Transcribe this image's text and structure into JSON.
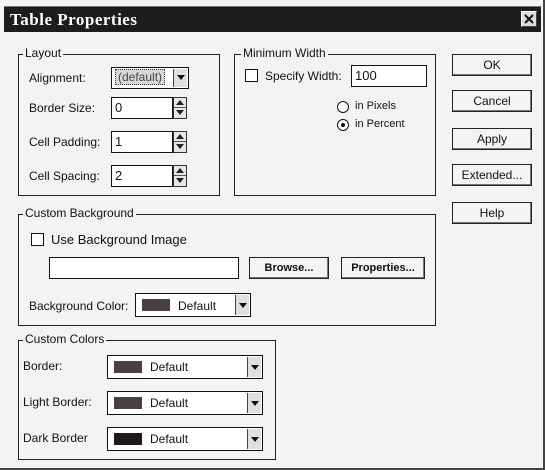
{
  "window": {
    "title": "Table Properties"
  },
  "layout_group": {
    "legend": "Layout",
    "alignment_label": "Alignment:",
    "alignment_value": "(default)",
    "border_size_label": "Border Size:",
    "border_size_value": "0",
    "cell_padding_label": "Cell Padding:",
    "cell_padding_value": "1",
    "cell_spacing_label": "Cell Spacing:",
    "cell_spacing_value": "2"
  },
  "min_width_group": {
    "legend": "Minimum Width",
    "specify_width_label": "Specify Width:",
    "specify_width_checked": false,
    "width_value": "100",
    "in_pixels_label": "in Pixels",
    "in_percent_label": "in Percent",
    "selected_unit": "in Percent"
  },
  "buttons": {
    "ok": "OK",
    "cancel": "Cancel",
    "apply": "Apply",
    "extended": "Extended...",
    "help": "Help"
  },
  "background_group": {
    "legend": "Custom Background",
    "use_image_label": "Use Background Image",
    "use_image_checked": false,
    "image_path": "",
    "browse_label": "Browse...",
    "properties_label": "Properties...",
    "color_label": "Background Color:",
    "color_value": "Default"
  },
  "colors_group": {
    "legend": "Custom Colors",
    "border_label": "Border:",
    "border_value": "Default",
    "light_border_label": "Light Border:",
    "light_border_value": "Default",
    "dark_border_label": "Dark Border",
    "dark_border_value": "Default"
  },
  "colors": {
    "title_bar": "#1d1d1d",
    "dialog_face": "#f3f3f3",
    "swatch_default": "#4a4040",
    "swatch_dark": "#1f1a1a"
  }
}
